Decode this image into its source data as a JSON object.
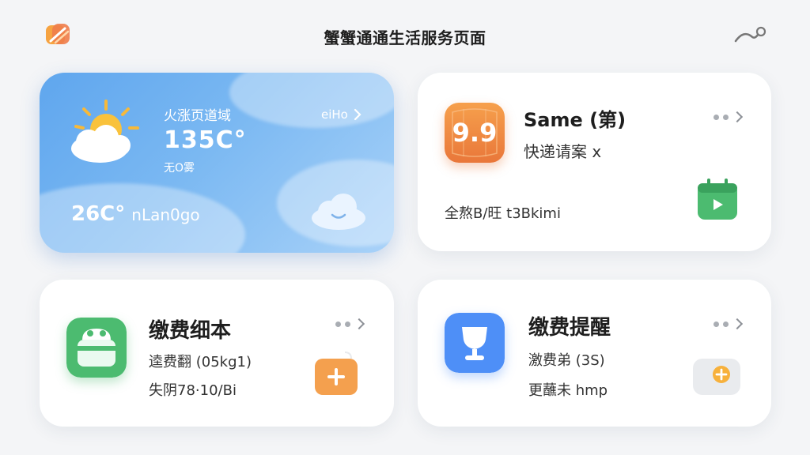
{
  "header": {
    "title": "蟹蟹通通生活服务页面",
    "logo_icon": "logo-icon",
    "right_icon": "profile-curve-icon"
  },
  "weather": {
    "label": "火涨页道域",
    "temperature": "135C°",
    "condition": "无O雾",
    "more_label": "eiHo",
    "bottom_temp": "26C°",
    "bottom_note": "nLan0go",
    "colors": {
      "from": "#5fa6ee",
      "to": "#a9d2f8"
    }
  },
  "express": {
    "badge": "9.9",
    "title": "Same (第)",
    "subtitle": "快递请案 x",
    "footer": "全熬B/旺 t3Bkimi",
    "action_icon": "calendar-play-icon",
    "accent": "#f08a35"
  },
  "bill_detail": {
    "title": "缴费细本",
    "line1": "逵费翻 (05kg1)",
    "line2": "失阴78·10/Bi",
    "icon": "basket-icon",
    "action_icon": "plus-icon",
    "accent": "#4cbb70"
  },
  "reminder": {
    "title": "缴费提醒",
    "line1": "激费弟 (3S)",
    "line2": "更蘸未 hmp",
    "icon": "trophy-icon",
    "action_icon": "plus-circle-icon",
    "accent": "#4e8ff7"
  }
}
